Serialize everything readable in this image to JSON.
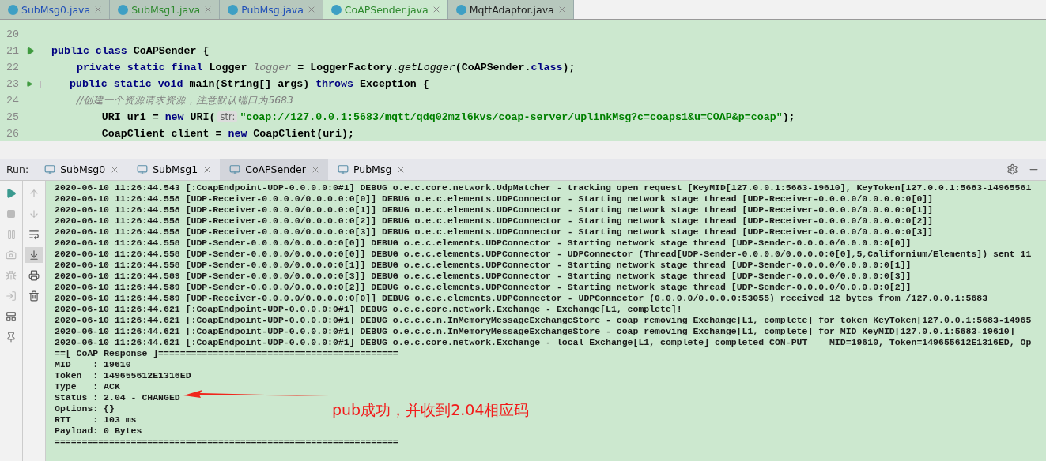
{
  "editor_tabs": [
    {
      "label": "SubMsg0.java",
      "selected": false,
      "color": "#2150b8"
    },
    {
      "label": "SubMsg1.java",
      "selected": false,
      "color": "#2f8a2f"
    },
    {
      "label": "PubMsg.java",
      "selected": false,
      "color": "#2150b8"
    },
    {
      "label": "CoAPSender.java",
      "selected": true,
      "color": "#2f8a2f"
    },
    {
      "label": "MqttAdaptor.java",
      "selected": false,
      "color": "#222222"
    }
  ],
  "code_lines": [
    {
      "number": "20",
      "run_marker": false,
      "fold": false
    },
    {
      "number": "21",
      "run_marker": true,
      "fold": false,
      "tokens": [
        {
          "kind": "keyword",
          "text": "public class "
        },
        {
          "kind": "plain",
          "text": "CoAPSender {"
        }
      ]
    },
    {
      "number": "22",
      "run_marker": false,
      "fold": false,
      "tokens": [
        {
          "kind": "keyword",
          "text": "    private static final "
        },
        {
          "kind": "plain",
          "text": "Logger "
        },
        {
          "kind": "field",
          "text": "logger"
        },
        {
          "kind": "plain",
          "text": " = LoggerFactory."
        },
        {
          "kind": "italic",
          "text": "getLogger"
        },
        {
          "kind": "plain",
          "text": "(CoAPSender."
        },
        {
          "kind": "keyword",
          "text": "class"
        },
        {
          "kind": "plain",
          "text": ");"
        }
      ]
    },
    {
      "number": "23",
      "run_marker": true,
      "fold": true,
      "tokens": [
        {
          "kind": "keyword",
          "text": "    public static void "
        },
        {
          "kind": "plain",
          "text": "main(String[] args) "
        },
        {
          "kind": "keyword",
          "text": "throws "
        },
        {
          "kind": "plain",
          "text": "Exception {"
        }
      ]
    },
    {
      "number": "24",
      "run_marker": false,
      "fold": false,
      "tokens": [
        {
          "kind": "comment",
          "text": "        //创建一个资源请求资源，注意默认端口为5683"
        }
      ]
    },
    {
      "number": "25",
      "run_marker": false,
      "fold": false,
      "tokens": [
        {
          "kind": "plain",
          "text": "        URI uri = "
        },
        {
          "kind": "keyword",
          "text": "new "
        },
        {
          "kind": "plain",
          "text": "URI("
        },
        {
          "kind": "hint",
          "text": "str:"
        },
        {
          "kind": "string",
          "text": "\"coap://127.0.0.1:5683/mqtt/qdq02mzl6kvs/coap-server/uplinkMsg?c=coaps1&u=COAP&p=coap\""
        },
        {
          "kind": "plain",
          "text": ");"
        }
      ]
    },
    {
      "number": "26",
      "run_marker": false,
      "fold": false,
      "tokens": [
        {
          "kind": "plain",
          "text": "        CoapClient client = "
        },
        {
          "kind": "keyword",
          "text": "new "
        },
        {
          "kind": "plain",
          "text": "CoapClient(uri);"
        }
      ]
    }
  ],
  "run": {
    "label": "Run:",
    "tabs": [
      {
        "label": "SubMsg0",
        "selected": false
      },
      {
        "label": "SubMsg1",
        "selected": false
      },
      {
        "label": "CoAPSender",
        "selected": true
      },
      {
        "label": "PubMsg",
        "selected": false
      }
    ]
  },
  "console_lines": [
    "2020-06-10 11:26:44.543 [:CoapEndpoint-UDP-0.0.0.0:0#1] DEBUG o.e.c.core.network.UdpMatcher - tracking open request [KeyMID[127.0.0.1:5683-19610], KeyToken[127.0.0.1:5683-14965561",
    "2020-06-10 11:26:44.558 [UDP-Receiver-0.0.0.0/0.0.0.0:0[0]] DEBUG o.e.c.elements.UDPConnector - Starting network stage thread [UDP-Receiver-0.0.0.0/0.0.0.0:0[0]]",
    "2020-06-10 11:26:44.558 [UDP-Receiver-0.0.0.0/0.0.0.0:0[1]] DEBUG o.e.c.elements.UDPConnector - Starting network stage thread [UDP-Receiver-0.0.0.0/0.0.0.0:0[1]]",
    "2020-06-10 11:26:44.558 [UDP-Receiver-0.0.0.0/0.0.0.0:0[2]] DEBUG o.e.c.elements.UDPConnector - Starting network stage thread [UDP-Receiver-0.0.0.0/0.0.0.0:0[2]]",
    "2020-06-10 11:26:44.558 [UDP-Receiver-0.0.0.0/0.0.0.0:0[3]] DEBUG o.e.c.elements.UDPConnector - Starting network stage thread [UDP-Receiver-0.0.0.0/0.0.0.0:0[3]]",
    "2020-06-10 11:26:44.558 [UDP-Sender-0.0.0.0/0.0.0.0:0[0]] DEBUG o.e.c.elements.UDPConnector - Starting network stage thread [UDP-Sender-0.0.0.0/0.0.0.0:0[0]]",
    "2020-06-10 11:26:44.558 [UDP-Sender-0.0.0.0/0.0.0.0:0[0]] DEBUG o.e.c.elements.UDPConnector - UDPConnector (Thread[UDP-Sender-0.0.0.0/0.0.0.0:0[0],5,Californium/Elements]) sent 11",
    "2020-06-10 11:26:44.558 [UDP-Sender-0.0.0.0/0.0.0.0:0[1]] DEBUG o.e.c.elements.UDPConnector - Starting network stage thread [UDP-Sender-0.0.0.0/0.0.0.0:0[1]]",
    "2020-06-10 11:26:44.589 [UDP-Sender-0.0.0.0/0.0.0.0:0[3]] DEBUG o.e.c.elements.UDPConnector - Starting network stage thread [UDP-Sender-0.0.0.0/0.0.0.0:0[3]]",
    "2020-06-10 11:26:44.589 [UDP-Sender-0.0.0.0/0.0.0.0:0[2]] DEBUG o.e.c.elements.UDPConnector - Starting network stage thread [UDP-Sender-0.0.0.0/0.0.0.0:0[2]]",
    "2020-06-10 11:26:44.589 [UDP-Receiver-0.0.0.0/0.0.0.0:0[0]] DEBUG o.e.c.elements.UDPConnector - UDPConnector (0.0.0.0/0.0.0.0:53055) received 12 bytes from /127.0.0.1:5683",
    "2020-06-10 11:26:44.621 [:CoapEndpoint-UDP-0.0.0.0:0#1] DEBUG o.e.c.core.network.Exchange - Exchange[L1, complete]!",
    "2020-06-10 11:26:44.621 [:CoapEndpoint-UDP-0.0.0.0:0#1] DEBUG o.e.c.c.n.InMemoryMessageExchangeStore - coap removing Exchange[L1, complete] for token KeyToken[127.0.0.1:5683-14965",
    "2020-06-10 11:26:44.621 [:CoapEndpoint-UDP-0.0.0.0:0#1] DEBUG o.e.c.c.n.InMemoryMessageExchangeStore - coap removing Exchange[L1, complete] for MID KeyMID[127.0.0.1:5683-19610]",
    "2020-06-10 11:26:44.621 [:CoapEndpoint-UDP-0.0.0.0:0#1] DEBUG o.e.c.core.network.Exchange - local Exchange[L1, complete] completed CON-PUT    MID=19610, Token=149655612E1316ED, Op",
    "==[ CoAP Response ]============================================",
    "MID    : 19610",
    "Token  : 149655612E1316ED",
    "Type   : ACK",
    "Status : 2.04 - CHANGED",
    "Options: {}",
    "RTT    : 103 ms",
    "Payload: 0 Bytes",
    "==============================================================="
  ],
  "annotation": {
    "text": "pub成功，并收到2.04相应码"
  }
}
